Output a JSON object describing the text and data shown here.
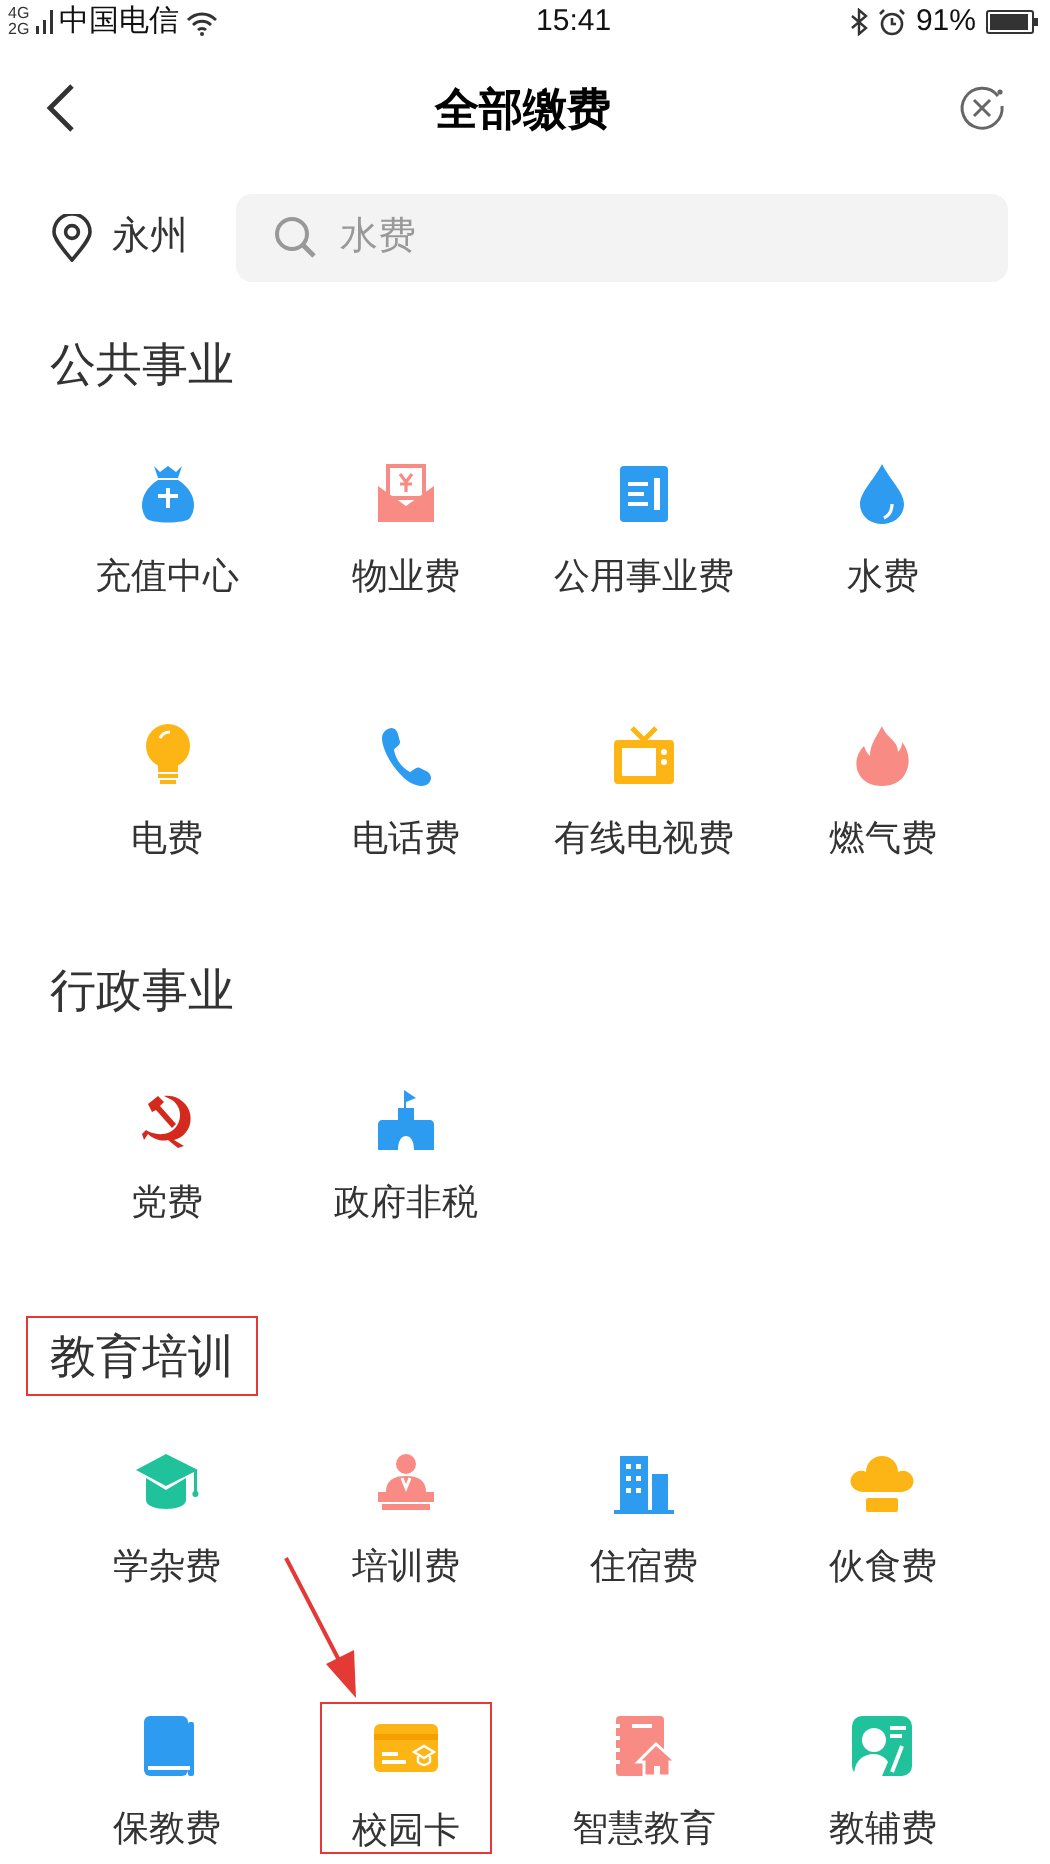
{
  "status_bar": {
    "network_top": "4G",
    "network_bottom": "2G",
    "carrier": "中国电信",
    "time": "15:41",
    "battery": "91%"
  },
  "header": {
    "title": "全部缴费"
  },
  "search": {
    "city": "永州",
    "placeholder": "水费"
  },
  "sections": [
    {
      "title": "公共事业",
      "highlighted": false,
      "items": [
        {
          "label": "充值中心",
          "highlighted": false
        },
        {
          "label": "物业费",
          "highlighted": false
        },
        {
          "label": "公用事业费",
          "highlighted": false
        },
        {
          "label": "水费",
          "highlighted": false
        },
        {
          "label": "电费",
          "highlighted": false
        },
        {
          "label": "电话费",
          "highlighted": false
        },
        {
          "label": "有线电视费",
          "highlighted": false
        },
        {
          "label": "燃气费",
          "highlighted": false
        }
      ]
    },
    {
      "title": "行政事业",
      "highlighted": false,
      "items": [
        {
          "label": "党费",
          "highlighted": false
        },
        {
          "label": "政府非税",
          "highlighted": false
        }
      ]
    },
    {
      "title": "教育培训",
      "highlighted": true,
      "items": [
        {
          "label": "学杂费",
          "highlighted": false
        },
        {
          "label": "培训费",
          "highlighted": false
        },
        {
          "label": "住宿费",
          "highlighted": false
        },
        {
          "label": "伙食费",
          "highlighted": false
        },
        {
          "label": "保教费",
          "highlighted": false
        },
        {
          "label": "校园卡",
          "highlighted": true
        },
        {
          "label": "智慧教育",
          "highlighted": false
        },
        {
          "label": "教辅费",
          "highlighted": false
        }
      ]
    }
  ]
}
